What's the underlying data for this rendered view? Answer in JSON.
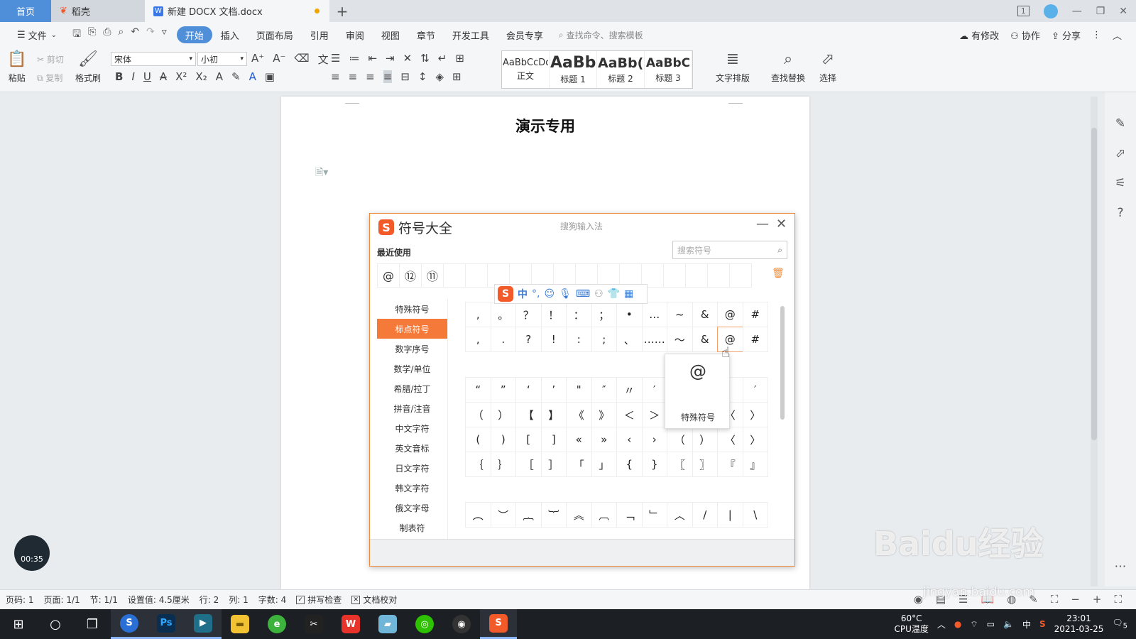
{
  "titlebar": {
    "tabs": [
      {
        "label": "首页"
      },
      {
        "label": "稻壳"
      },
      {
        "label": "新建 DOCX 文档.docx"
      }
    ],
    "new_tab": "+",
    "win_badge": "1"
  },
  "menubar": {
    "file": "文件",
    "items": [
      "开始",
      "插入",
      "页面布局",
      "引用",
      "审阅",
      "视图",
      "章节",
      "开发工具",
      "会员专享"
    ],
    "search_placeholder": "查找命令、搜索模板",
    "right": [
      "有修改",
      "协作",
      "分享"
    ]
  },
  "ribbon": {
    "paste": "粘贴",
    "cut": "剪切",
    "copy": "复制",
    "format_painter": "格式刷",
    "font_name": "宋体",
    "font_size": "小初",
    "styles": [
      {
        "preview": "AaBbCcDd",
        "name": "正文"
      },
      {
        "preview": "AaBb",
        "name": "标题 1"
      },
      {
        "preview": "AaBb(",
        "name": "标题 2"
      },
      {
        "preview": "AaBbC",
        "name": "标题 3"
      }
    ],
    "text_layout": "文字排版",
    "find_replace": "查找替换",
    "select": "选择"
  },
  "document": {
    "title": "演示专用"
  },
  "dialog": {
    "title": "符号大全",
    "ime": "搜狗输入法",
    "recent_label": "最近使用",
    "search_placeholder": "搜索符号",
    "recent": [
      "@",
      "⑫",
      "⑪",
      "",
      "",
      "",
      "",
      "",
      "",
      "",
      "",
      "",
      "",
      "",
      "",
      "",
      ""
    ],
    "categories": [
      "特殊符号",
      "标点符号",
      "数字序号",
      "数学/单位",
      "希腊/拉丁",
      "拼音/注音",
      "中文字符",
      "英文音标",
      "日文字符",
      "韩文字符",
      "俄文字母",
      "制表符"
    ],
    "selected_category": 1,
    "grid_top": [
      ",",
      "。",
      "？",
      "！",
      "：",
      "；",
      "•",
      "…",
      "~",
      "&",
      "@",
      "#",
      ",",
      ".",
      "?",
      "!",
      ":",
      ";",
      "、",
      "……",
      "～",
      "&",
      "@",
      "#"
    ],
    "grid_mid": [
      "“",
      "”",
      "‘",
      "’",
      "\"",
      "″",
      "〃",
      "′",
      "",
      "",
      "",
      "′",
      "（",
      "）",
      "【",
      "】",
      "《",
      "》",
      "＜",
      "＞",
      "",
      "",
      "〈",
      "〉",
      "(",
      ")",
      "[",
      "]",
      "«",
      "»",
      "‹",
      "›",
      "（",
      "）",
      "〈",
      "〉",
      "｛",
      "｝",
      "［",
      "］",
      "「",
      "」",
      "{",
      "}",
      "〖",
      "〗",
      "『",
      "』"
    ],
    "grid_bottom": [
      "︵",
      "︶",
      "︷",
      "︸",
      "︽",
      "︹",
      "﹁",
      "﹂",
      "︿",
      "/",
      "|",
      "\\"
    ],
    "popup_glyph": "@",
    "popup_label": "特殊符号"
  },
  "sogou_bar": {
    "mode": "中",
    "punct": "°,"
  },
  "timer": "00:35",
  "status": {
    "items": [
      "页码: 1",
      "页面: 1/1",
      "节: 1/1",
      "设置值: 4.5厘米",
      "行: 2",
      "列: 1",
      "字数: 4"
    ],
    "spell": "拼写检查",
    "proof": "文档校对"
  },
  "tray": {
    "temp": "60°C",
    "temp_label": "CPU温度",
    "ime": "中",
    "time": "23:01",
    "date": "2021-03-25",
    "notif": "5"
  },
  "watermark": {
    "text": "Baidu经验",
    "url": "jingyan.baidu.com"
  },
  "colors": {
    "accent": "#4f8ed8",
    "sogou": "#f25a29",
    "dialog_border": "#f08a3c"
  }
}
